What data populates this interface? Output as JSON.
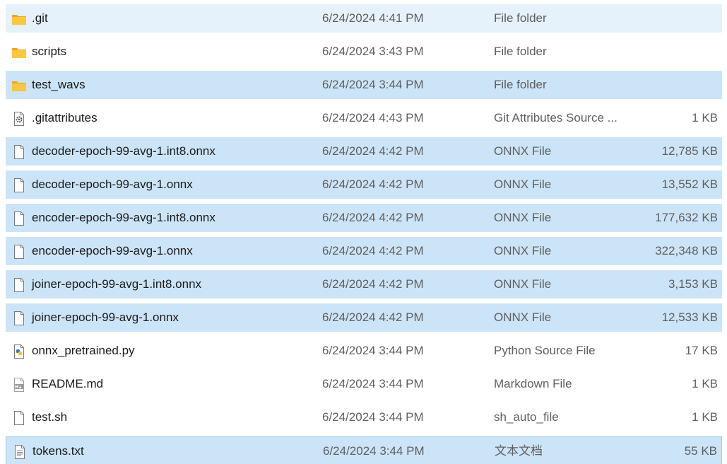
{
  "files": [
    {
      "name": ".git",
      "date": "6/24/2024 4:41 PM",
      "type": "File folder",
      "size": "",
      "icon": "folder-icon",
      "state": "hover"
    },
    {
      "name": "scripts",
      "date": "6/24/2024 3:43 PM",
      "type": "File folder",
      "size": "",
      "icon": "folder-icon",
      "state": "normal"
    },
    {
      "name": "test_wavs",
      "date": "6/24/2024 3:44 PM",
      "type": "File folder",
      "size": "",
      "icon": "folder-icon",
      "state": "selected"
    },
    {
      "name": ".gitattributes",
      "date": "6/24/2024 4:43 PM",
      "type": "Git Attributes Source ...",
      "size": "1 KB",
      "icon": "settings-file-icon",
      "state": "normal"
    },
    {
      "name": "decoder-epoch-99-avg-1.int8.onnx",
      "date": "6/24/2024 4:42 PM",
      "type": "ONNX File",
      "size": "12,785 KB",
      "icon": "file-icon",
      "state": "selected"
    },
    {
      "name": "decoder-epoch-99-avg-1.onnx",
      "date": "6/24/2024 4:42 PM",
      "type": "ONNX File",
      "size": "13,552 KB",
      "icon": "file-icon",
      "state": "selected"
    },
    {
      "name": "encoder-epoch-99-avg-1.int8.onnx",
      "date": "6/24/2024 4:42 PM",
      "type": "ONNX File",
      "size": "177,632 KB",
      "icon": "file-icon",
      "state": "selected"
    },
    {
      "name": "encoder-epoch-99-avg-1.onnx",
      "date": "6/24/2024 4:42 PM",
      "type": "ONNX File",
      "size": "322,348 KB",
      "icon": "file-icon",
      "state": "selected"
    },
    {
      "name": "joiner-epoch-99-avg-1.int8.onnx",
      "date": "6/24/2024 4:42 PM",
      "type": "ONNX File",
      "size": "3,153 KB",
      "icon": "file-icon",
      "state": "selected"
    },
    {
      "name": "joiner-epoch-99-avg-1.onnx",
      "date": "6/24/2024 4:42 PM",
      "type": "ONNX File",
      "size": "12,533 KB",
      "icon": "file-icon",
      "state": "selected"
    },
    {
      "name": "onnx_pretrained.py",
      "date": "6/24/2024 3:44 PM",
      "type": "Python Source File",
      "size": "17 KB",
      "icon": "python-file-icon",
      "state": "normal"
    },
    {
      "name": "README.md",
      "date": "6/24/2024 3:44 PM",
      "type": "Markdown File",
      "size": "1 KB",
      "icon": "markdown-file-icon",
      "state": "normal"
    },
    {
      "name": "test.sh",
      "date": "6/24/2024 3:44 PM",
      "type": "sh_auto_file",
      "size": "1 KB",
      "icon": "file-icon",
      "state": "normal"
    },
    {
      "name": "tokens.txt",
      "date": "6/24/2024 3:44 PM",
      "type": "文本文档",
      "size": "55 KB",
      "icon": "text-file-icon",
      "state": "focused-selected"
    }
  ],
  "colors": {
    "selected_bg": "#cce4f7",
    "hover_bg": "#e5f1fb",
    "focus_border": "#99c9ef",
    "secondary_text": "#5f5f5f",
    "folder_yellow": "#f8c840"
  }
}
